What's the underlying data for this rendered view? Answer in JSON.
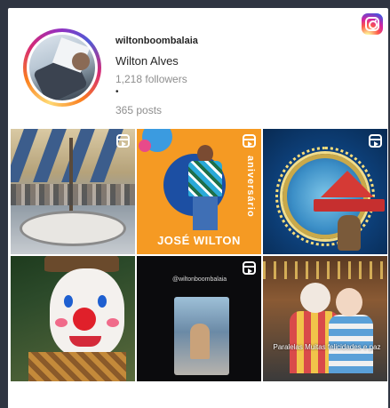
{
  "profile": {
    "username": "wiltonboombalaia",
    "full_name": "Wilton Alves",
    "followers": "1,218 followers",
    "separator": "•",
    "posts": "365 posts"
  },
  "posts": [
    {
      "id": "post-1",
      "is_reel": true
    },
    {
      "id": "post-2",
      "is_reel": true,
      "overlay_name": "JOSÉ WILTON",
      "overlay_side": "aniversário"
    },
    {
      "id": "post-3",
      "is_reel": true
    },
    {
      "id": "post-4",
      "is_reel": false
    },
    {
      "id": "post-5",
      "is_reel": true,
      "overlay_caption": "@wiltonboombalaia"
    },
    {
      "id": "post-6",
      "is_reel": false,
      "overlay_caption": "Paralelas Muitas felicidades e paz"
    }
  ],
  "icons": {
    "brand": "instagram-icon",
    "reel": "reel-icon"
  },
  "colors": {
    "page_background": "#2f3542",
    "card_background": "#ffffff",
    "muted_text": "#8e8e8e",
    "primary_text": "#262626"
  }
}
